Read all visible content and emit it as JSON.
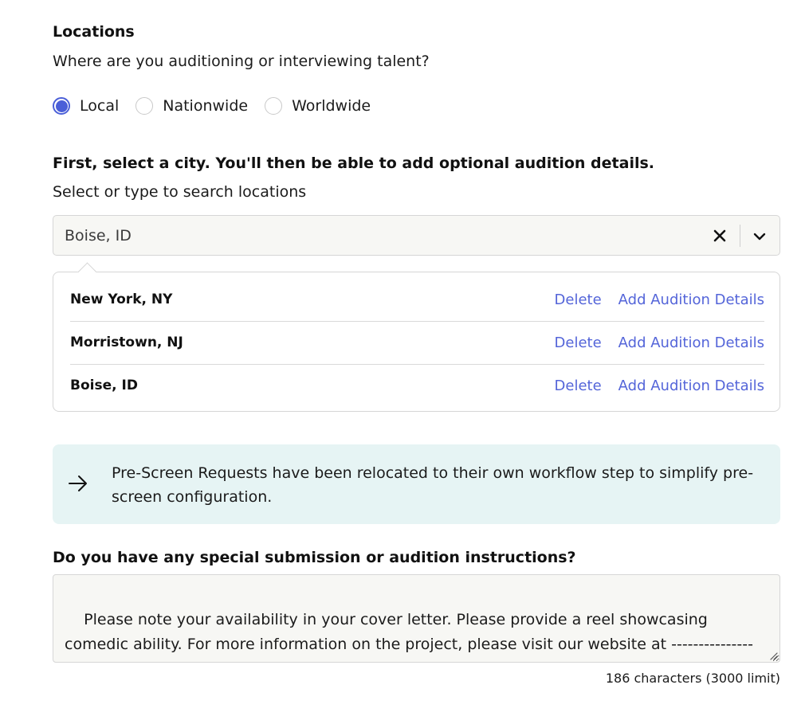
{
  "locations_section": {
    "title": "Locations",
    "question": "Where are you auditioning or interviewing talent?",
    "radio_options": [
      {
        "label": "Local",
        "checked": true
      },
      {
        "label": "Nationwide",
        "checked": false
      },
      {
        "label": "Worldwide",
        "checked": false
      }
    ]
  },
  "city_section": {
    "heading": "First, select a city. You'll then be able to add optional audition details.",
    "search_label": "Select or type to search locations",
    "selected_value": "Boise, ID"
  },
  "location_list": [
    {
      "name": "New York, NY",
      "delete_label": "Delete",
      "details_label": "Add Audition Details"
    },
    {
      "name": "Morristown, NJ",
      "delete_label": "Delete",
      "details_label": "Add Audition Details"
    },
    {
      "name": "Boise, ID",
      "delete_label": "Delete",
      "details_label": "Add Audition Details"
    }
  ],
  "info_banner": {
    "icon": "arrow-right-icon",
    "text": "Pre-Screen Requests have been relocated to their own workflow step to simplify pre-screen configuration."
  },
  "instructions": {
    "heading": "Do you have any special submission or audition instructions?",
    "value": "Please note your availability in your cover letter. Please provide a reel showcasing comedic ability. For more information on the project, please visit our website at ----------------.com",
    "char_count": "186 characters (3000 limit)"
  },
  "colors": {
    "accent": "#4b5fd8",
    "link": "#5465d9",
    "info_bg": "#e6f4f4",
    "field_bg": "#f7f7f4"
  }
}
